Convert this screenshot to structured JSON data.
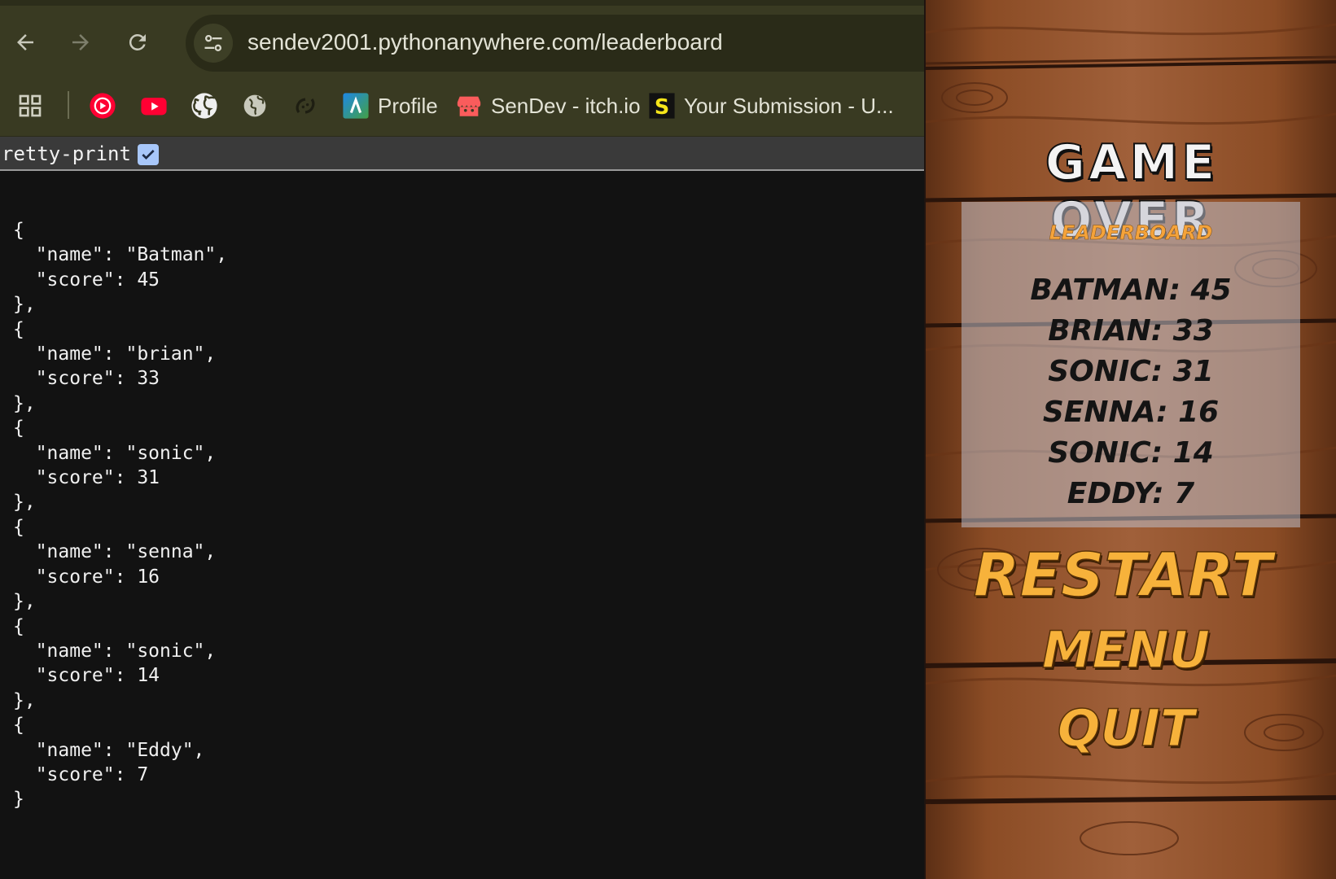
{
  "browser": {
    "url": "sendev2001.pythonanywhere.com/leaderboard",
    "nav": {
      "back_icon": "back-arrow-icon",
      "forward_icon": "forward-arrow-icon",
      "reload_icon": "reload-icon",
      "site_info_icon": "tune-icon"
    },
    "bookmarks": [
      {
        "icon": "apps-grid-icon",
        "label": ""
      },
      {
        "icon": "youtube-music-icon",
        "label": ""
      },
      {
        "icon": "youtube-icon",
        "label": ""
      },
      {
        "icon": "github-icon",
        "label": ""
      },
      {
        "icon": "globe-icon",
        "label": ""
      },
      {
        "icon": "swirl-icon",
        "label": ""
      },
      {
        "icon": "profile-app-icon",
        "label": "Profile"
      },
      {
        "icon": "itch-io-icon",
        "label": "SenDev - itch.io"
      },
      {
        "icon": "s-logo-icon",
        "label": "Your Submission - U..."
      }
    ],
    "pretty_print": {
      "label": "retty-print",
      "checked": true
    },
    "json_text": "{\n  \"name\": \"Batman\",\n  \"score\": 45\n},\n{\n  \"name\": \"brian\",\n  \"score\": 33\n},\n{\n  \"name\": \"sonic\",\n  \"score\": 31\n},\n{\n  \"name\": \"senna\",\n  \"score\": 16\n},\n{\n  \"name\": \"sonic\",\n  \"score\": 14\n},\n{\n  \"name\": \"Eddy\",\n  \"score\": 7\n}"
  },
  "game": {
    "title": "GAME OVER",
    "leaderboard_heading": "LEADERBOARD",
    "entries": [
      {
        "text": "BATMAN: 45"
      },
      {
        "text": "BRIAN: 33"
      },
      {
        "text": "SONIC: 31"
      },
      {
        "text": "SENNA: 16"
      },
      {
        "text": "SONIC: 14"
      },
      {
        "text": "EDDY: 7"
      }
    ],
    "buttons": {
      "restart": "RESTART",
      "menu": "MENU",
      "quit": "QUIT"
    }
  },
  "colors": {
    "browser_toolbar": "#393a22",
    "page_bg": "#121212",
    "wood": "#8a4b24",
    "menu_text": "#f7b23b"
  }
}
